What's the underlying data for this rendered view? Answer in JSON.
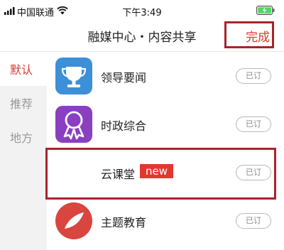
{
  "status_bar": {
    "carrier": "中国联通",
    "time": "下午3:49"
  },
  "nav": {
    "title": "融媒中心・内容共享",
    "done_label": "完成"
  },
  "sidebar": {
    "items": [
      {
        "label": "默认",
        "active": true
      },
      {
        "label": "推荐",
        "active": false
      },
      {
        "label": "地方",
        "active": false
      }
    ]
  },
  "channels": [
    {
      "name": "领导要闻",
      "icon": "trophy-icon",
      "button": "已订"
    },
    {
      "name": "时政综合",
      "icon": "award-ribbon-icon",
      "button": "已订"
    },
    {
      "name": "云课堂",
      "badge": "new",
      "icon": "blank-icon",
      "button": "已订"
    },
    {
      "name": "主题教育",
      "icon": "feather-quill-icon",
      "button": "已订"
    }
  ],
  "colors": {
    "accent_red": "#d93a2f",
    "annotation_red": "#a8242b",
    "sidebar_bg": "#f2f2f2",
    "trophy_blue": "#3d8fd8",
    "award_purple": "#8a3fc0",
    "education_red": "#d9463f"
  }
}
